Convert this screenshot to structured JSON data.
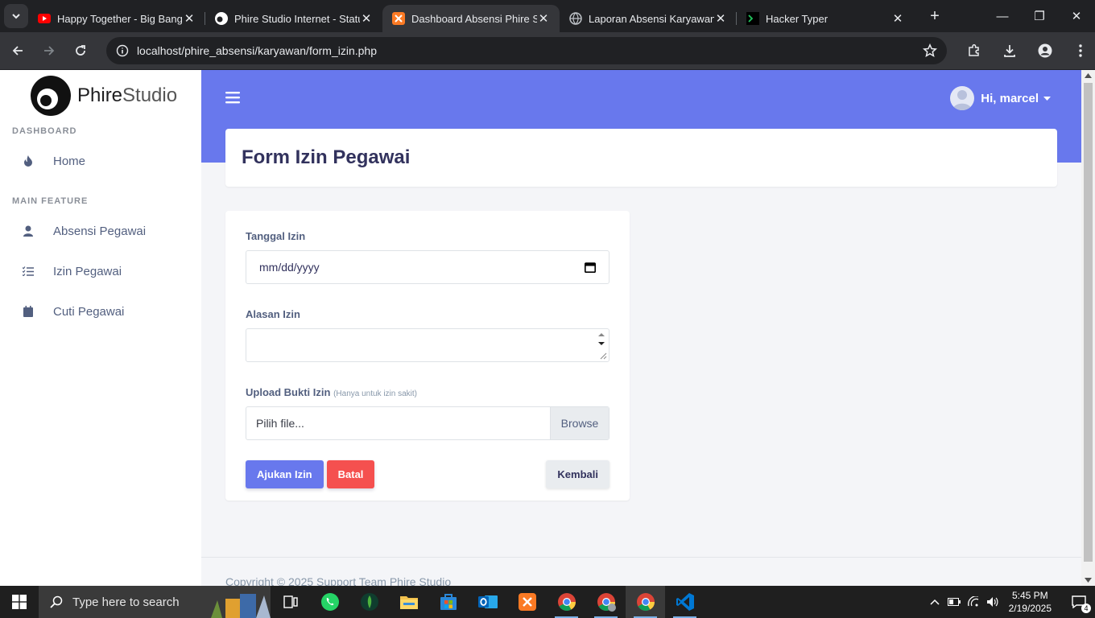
{
  "browser": {
    "tabs": [
      {
        "title": "Happy Together - Big Bang [",
        "icon": "youtube-icon"
      },
      {
        "title": "Phire Studio Internet - Statu",
        "icon": "phire-icon"
      },
      {
        "title": "Dashboard Absensi Phire Stu",
        "icon": "xampp-icon",
        "active": true
      },
      {
        "title": "Laporan Absensi Karyawan (",
        "icon": "globe-icon"
      },
      {
        "title": "Hacker Typer",
        "icon": "terminal-icon"
      }
    ],
    "url": "localhost/phire_absensi/karyawan/form_izin.php"
  },
  "app": {
    "brand_bold": "Phire",
    "brand_light": "Studio",
    "sidebar": {
      "section_dashboard": "DASHBOARD",
      "section_main": "MAIN FEATURE",
      "items": [
        {
          "label": "Home",
          "icon": "flame-icon"
        },
        {
          "label": "Absensi Pegawai",
          "icon": "user-icon"
        },
        {
          "label": "Izin Pegawai",
          "icon": "list-check-icon"
        },
        {
          "label": "Cuti Pegawai",
          "icon": "calendar-icon"
        }
      ]
    },
    "user_greeting": "Hi, marcel",
    "page_title": "Form Izin Pegawai",
    "form": {
      "date_label": "Tanggal Izin",
      "date_placeholder": "mm/dd/yyyy",
      "reason_label": "Alasan Izin",
      "upload_label": "Upload Bukti Izin",
      "upload_hint": "(Hanya untuk izin sakit)",
      "file_placeholder": "Pilih file...",
      "browse_label": "Browse",
      "submit_label": "Ajukan Izin",
      "cancel_label": "Batal",
      "back_label": "Kembali"
    },
    "footer": "Copyright © 2025 Support Team Phire Studio"
  },
  "taskbar": {
    "search_placeholder": "Type here to search",
    "time": "5:45 PM",
    "date": "2/19/2025",
    "notification_count": "4"
  }
}
